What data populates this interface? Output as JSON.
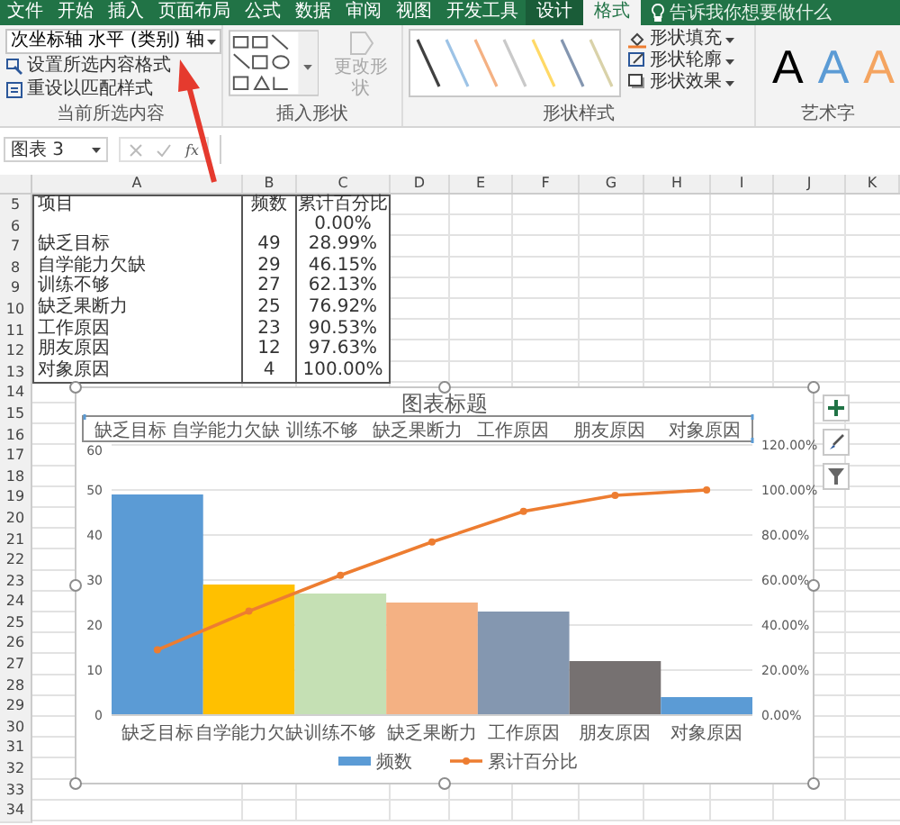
{
  "tabs": [
    {
      "label": "文件",
      "selected": false,
      "kind": "normal"
    },
    {
      "label": "开始",
      "selected": false,
      "kind": "normal"
    },
    {
      "label": "插入",
      "selected": false,
      "kind": "normal"
    },
    {
      "label": "页面布局",
      "selected": false,
      "kind": "normal"
    },
    {
      "label": "公式",
      "selected": false,
      "kind": "normal"
    },
    {
      "label": "数据",
      "selected": false,
      "kind": "normal"
    },
    {
      "label": "审阅",
      "selected": false,
      "kind": "normal"
    },
    {
      "label": "视图",
      "selected": false,
      "kind": "normal"
    },
    {
      "label": "开发工具",
      "selected": false,
      "kind": "normal"
    },
    {
      "label": "设计",
      "selected": false,
      "kind": "context"
    },
    {
      "label": "格式",
      "selected": true,
      "kind": "context"
    }
  ],
  "tell_me": {
    "placeholder": "告诉我你想要做什么"
  },
  "ribbon": {
    "selection": {
      "dropdown": "次坐标轴 水平 (类别) 轴",
      "buttons": [
        "设置所选内容格式",
        "重设以匹配样式"
      ],
      "label": "当前所选内容"
    },
    "insert_shapes": {
      "change_shape": {
        "label": "更改形状",
        "disabled": true
      },
      "label": "插入形状"
    },
    "shape_styles": {
      "swatches": [
        {
          "color": "#404040"
        },
        {
          "color": "#9dc3e6"
        },
        {
          "color": "#f4b183"
        },
        {
          "color": "#c9c9c9"
        },
        {
          "color": "#ffd966"
        },
        {
          "color": "#8496b0"
        },
        {
          "color": "#d9d2a9"
        }
      ],
      "buttons": [
        "形状填充",
        "形状轮廓",
        "形状效果"
      ],
      "label": "形状样式"
    },
    "wordart": {
      "samples": [
        {
          "text": "A",
          "color": "#000000"
        },
        {
          "text": "A",
          "color": "#5b9bd5"
        },
        {
          "text": "A",
          "color": "#f4a460"
        }
      ],
      "label": "艺术字"
    }
  },
  "formula_bar": {
    "name_box": "图表 3",
    "function_label": "fx"
  },
  "sheet": {
    "columns": [
      "A",
      "B",
      "C",
      "D",
      "E",
      "F",
      "G",
      "H",
      "I",
      "J",
      "K"
    ],
    "rows": [
      {
        "number": "5",
        "cells": [
          "项目",
          "频数",
          "累计百分比"
        ]
      },
      {
        "number": "6",
        "cells": [
          null,
          null,
          "0.00%"
        ]
      },
      {
        "number": "7",
        "cells": [
          "缺乏目标",
          "49",
          "28.99%"
        ]
      },
      {
        "number": "8",
        "cells": [
          "自学能力欠缺",
          "29",
          "46.15%"
        ]
      },
      {
        "number": "9",
        "cells": [
          "训练不够",
          "27",
          "62.13%"
        ]
      },
      {
        "number": "10",
        "cells": [
          "缺乏果断力",
          "25",
          "76.92%"
        ]
      },
      {
        "number": "11",
        "cells": [
          "工作原因",
          "23",
          "90.53%"
        ]
      },
      {
        "number": "12",
        "cells": [
          "朋友原因",
          "12",
          "97.63%"
        ]
      },
      {
        "number": "13",
        "cells": [
          "对象原因",
          "4",
          "100.00%"
        ]
      }
    ],
    "empty_rows": [
      "14",
      "15",
      "16",
      "17",
      "18",
      "19",
      "20",
      "21",
      "22",
      "23",
      "24",
      "25",
      "26",
      "27",
      "28",
      "29",
      "30",
      "31",
      "32",
      "33",
      "34"
    ]
  },
  "chart": {
    "secondary_axis_labels": [
      "缺乏目标",
      "自学能力欠缺",
      "训练不够",
      "缺乏果断力",
      "工作原因",
      "朋友原因",
      "对象原因"
    ],
    "chart_data": {
      "type": "bar",
      "title": "图表标题",
      "categories": [
        "缺乏目标",
        "自学能力欠缺",
        "训练不够",
        "缺乏果断力",
        "工作原因",
        "朋友原因",
        "对象原因"
      ],
      "series": [
        {
          "name": "频数",
          "type": "bar",
          "colors": [
            "#5b9bd5",
            "#ffc000",
            "#c5e0b4",
            "#f4b183",
            "#8497b0",
            "#767171",
            "#5b9bd5"
          ],
          "values": [
            49,
            29,
            27,
            25,
            23,
            12,
            4
          ]
        },
        {
          "name": "累计百分比",
          "type": "line",
          "axis": "y2",
          "marker": true,
          "color": "#ed7d31",
          "values": [
            29.0,
            46.2,
            62.1,
            76.9,
            90.5,
            97.6,
            100
          ]
        }
      ],
      "grid": true,
      "legend": "bottom",
      "ylim": [
        0,
        60
      ],
      "yticks": [
        0,
        10,
        20,
        30,
        40,
        50,
        60
      ],
      "y2lim": [
        0,
        120
      ],
      "y2ticks": [
        {
          "value": 0,
          "label": "0.00%"
        },
        {
          "value": 20,
          "label": "20.00%"
        },
        {
          "value": 40,
          "label": "40.00%"
        },
        {
          "value": 60,
          "label": "60.00%"
        },
        {
          "value": 80,
          "label": "80.00%"
        },
        {
          "value": 100,
          "label": "100.00%"
        },
        {
          "value": 120,
          "label": "120.00%"
        }
      ]
    }
  }
}
